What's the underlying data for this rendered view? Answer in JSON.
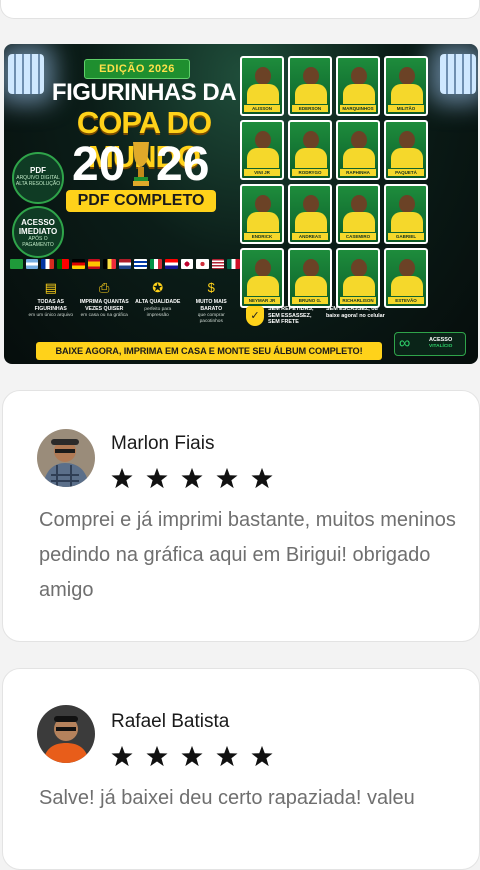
{
  "banner": {
    "edition": "EDIÇÃO 2026",
    "title_line1": "FIGURINHAS DA",
    "title_line2": "COPA DO MUNDO",
    "year_left": "20",
    "year_right": "26",
    "pdf_badge": "PDF COMPLETO",
    "circle1": {
      "big": "PDF",
      "small": "ARQUIVO DIGITAL ALTA RESOLUÇÃO"
    },
    "circle2": {
      "big": "ACESSO IMEDIATO",
      "small": "APÓS O PAGAMENTO"
    },
    "features": [
      {
        "icon": "album-icon",
        "title": "TODAS AS FIGURINHAS",
        "sub": "em um único arquivo"
      },
      {
        "icon": "printer-icon",
        "title": "IMPRIMA QUANTAS VEZES QUISER",
        "sub": "em casa ou na gráfica"
      },
      {
        "icon": "medal-icon",
        "title": "ALTA QUALIDADE",
        "sub": "perfeito para impressão"
      },
      {
        "icon": "piggy-bank-icon",
        "title": "MUITO MAIS BARATO",
        "sub": "que comprar pacotinhos"
      }
    ],
    "promo_left": "SEM REPETIDAS, SEM ESSASSEZ, SEM FRETE",
    "promo_right": "SEM ESCASSEZ, ou baixe agora! no celular",
    "acesso_line1": "ACESSO",
    "acesso_line2": "VITALÍCIO",
    "cta": "BAIXE AGORA, IMPRIMA EM CASA E MONTE SEU ÁLBUM COMPLETO!",
    "stickers": [
      "ALISSON BECKER",
      "EDERSON",
      "MARQUINHOS",
      "MILITÃO",
      "VINI JR",
      "RODRYGO",
      "RAPHINHA",
      "PAQUETÁ",
      "ENDRICK",
      "ANDREAS PEREIRA",
      "CASEMIRO",
      "GABRIEL MARTINELLI",
      "NEYMAR JR",
      "BRUNO G.",
      "RICHARLISON",
      "ESTEVÃO"
    ],
    "colors": {
      "yellow": "#ffd21a",
      "green": "#1f8f2f"
    }
  },
  "reviews": [
    {
      "name": "Marlon Fiais",
      "rating": 5,
      "text": "Comprei e já imprimi bastante, muitos meninos pedindo na gráfica aqui em Birigui! obrigado amigo"
    },
    {
      "name": "Rafael Batista",
      "rating": 5,
      "text": "Salve! já baixei deu certo rapaziada! valeu"
    }
  ]
}
